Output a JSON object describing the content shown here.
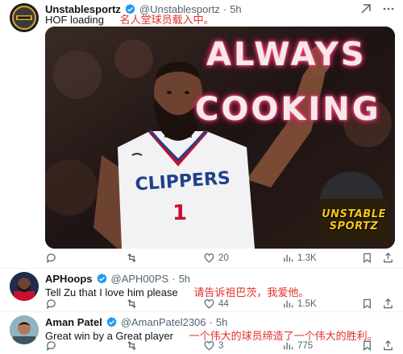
{
  "tweets": [
    {
      "name": "Unstablesportz",
      "handle": "@Unstablesportz",
      "dot": "·",
      "time": "5h",
      "text": "HOF loading",
      "translation": "名人堂球员载入中。",
      "media": {
        "overlay_line1": "ALWAYS",
        "overlay_line2": "COOKING",
        "jersey_text": "CLIPPERS",
        "jersey_number": "1",
        "brand_line1": "UNSTABLE",
        "brand_line2": "SPORTZ"
      },
      "likes": "20",
      "views": "1.3K"
    },
    {
      "name": "APHoops",
      "handle": "@APH00PS",
      "dot": "·",
      "time": "5h",
      "text": "Tell Zu that I love him please",
      "translation": "请告诉祖巴茨，我爱他。",
      "likes": "44",
      "views": "1.5K"
    },
    {
      "name": "Aman Patel",
      "handle": "@AmanPatel2306",
      "dot": "·",
      "time": "5h",
      "text": "Great win by a Great player",
      "translation": "一个伟大的球员缔造了一个伟大的胜利。",
      "likes": "3",
      "views": "775"
    }
  ],
  "colors": {
    "verified": "#1d9bf0",
    "translation": "#e0312b",
    "secondary": "#536471"
  },
  "icons": [
    "reply-icon",
    "retweet-icon",
    "like-icon",
    "views-icon",
    "bookmark-icon",
    "share-icon",
    "grok-icon",
    "more-icon",
    "verified-badge-icon"
  ]
}
